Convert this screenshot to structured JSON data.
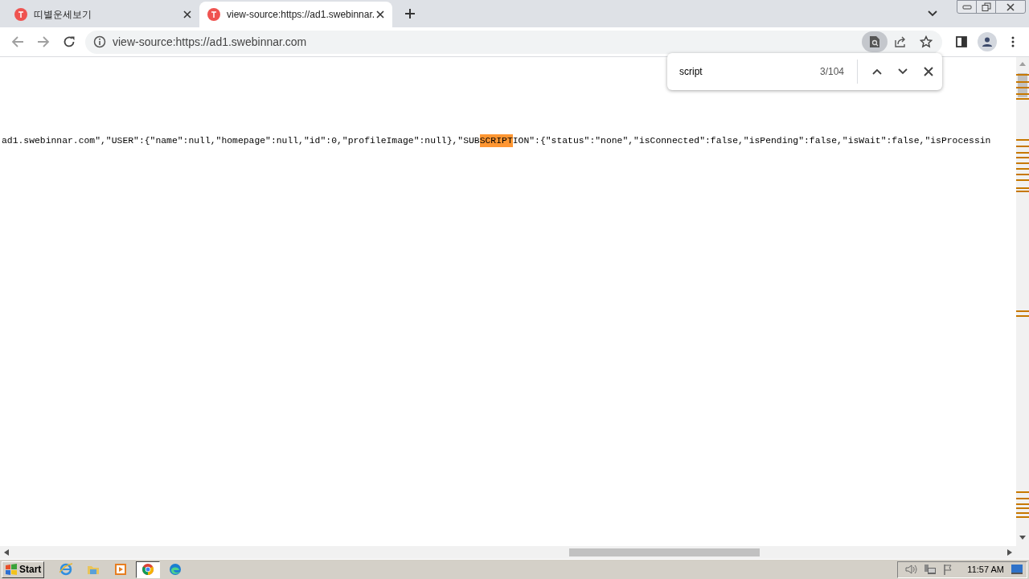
{
  "tabs": [
    {
      "title": "띠별운세보기",
      "selected": false
    },
    {
      "title": "view-source:https://ad1.swebinnar.",
      "selected": true
    }
  ],
  "address_bar": {
    "url": "view-source:https://ad1.swebinnar.com"
  },
  "find_bar": {
    "query": "script",
    "count": "3/104"
  },
  "source_line": {
    "before": "ad1.swebinnar.com\",\"USER\":{\"name\":null,\"homepage\":null,\"id\":0,\"profileImage\":null},\"SUB",
    "match": "SCRIPT",
    "after": "ION\":{\"status\":\"none\",\"isConnected\":false,\"isPending\":false,\"isWait\":false,\"isProcessin"
  },
  "taskbar": {
    "start": "Start",
    "apps": [
      {
        "kind": "browser",
        "selected": false
      },
      {
        "kind": "folder",
        "selected": false
      },
      {
        "kind": "player",
        "selected": false
      },
      {
        "kind": "chrome",
        "selected": true
      },
      {
        "kind": "edge",
        "selected": false
      }
    ],
    "clock": "11:57 AM"
  }
}
